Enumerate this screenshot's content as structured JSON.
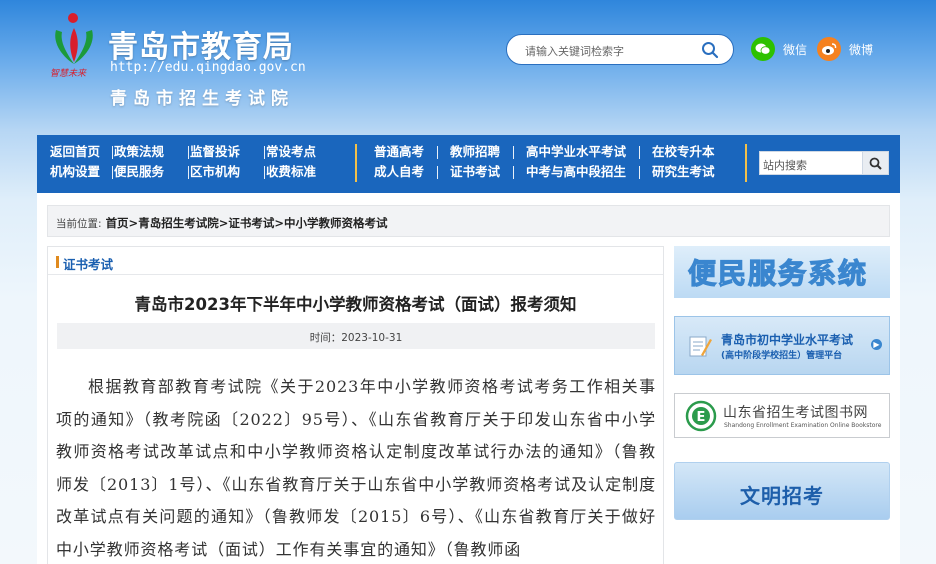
{
  "header": {
    "title": "青岛市教育局",
    "url": "http://edu.qingdao.gov.cn",
    "subtitle": "青岛市招生考试院",
    "logo_caption": "智慧未来",
    "search_placeholder": "请输入关键词检索字",
    "social": [
      {
        "label": "微信",
        "icon": "wechat-icon",
        "color": "#2dc100"
      },
      {
        "label": "微博",
        "icon": "weibo-icon",
        "color": "#f5811f"
      }
    ]
  },
  "nav": {
    "group1": [
      "返回首页",
      "政策法规",
      "监督投诉",
      "常设考点",
      "机构设置",
      "便民服务",
      "区市机构",
      "收费标准"
    ],
    "group2": [
      "普通高考",
      "教师招聘",
      "高中学业水平考试",
      "在校专升本",
      "成人自考",
      "证书考试",
      "中考与高中段招生",
      "研究生考试"
    ],
    "search_placeholder": "站内搜索"
  },
  "breadcrumb": {
    "label": "当前位置:",
    "path": "首页>青岛招生考试院>证书考试>中小学教师资格考试"
  },
  "article": {
    "category": "证书考试",
    "title": "青岛市2023年下半年中小学教师资格考试（面试）报考须知",
    "meta": "时间：2023-10-31",
    "body": "根据教育部教育考试院《关于2023年中小学教师资格考试考务工作相关事项的通知》（教考院函〔2022〕95号）、《山东省教育厅关于印发山东省中小学教师资格考试改革试点和中小学教师资格认定制度改革试行办法的通知》（鲁教师发〔2013〕1号）、《山东省教育厅关于山东省中小学教师资格考试及认定制度改革试点有关问题的通知》（鲁教师发〔2015〕6号）、《山东省教育厅关于做好中小学教师资格考试（面试）工作有关事宜的通知》（鲁教师函"
  },
  "sidebar": {
    "banner1": "便民服务系统",
    "banner2_line1": "青岛市初中学业水平考试",
    "banner2_line2": "(高中阶段学校招生）管理平台",
    "banner3_line1": "山东省招生考试图书网",
    "banner3_line2": "Shandong Enrollment Examination Online Bookstore",
    "banner4": "文明招考"
  },
  "colors": {
    "nav_bg": "#1a66bd",
    "accent": "#f3c14b",
    "link": "#1a5fb0"
  }
}
